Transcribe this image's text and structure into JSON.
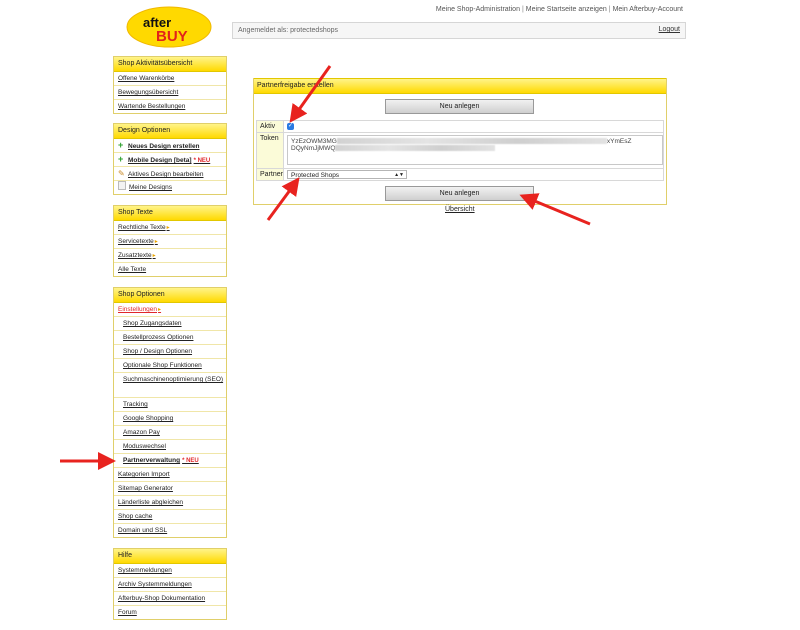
{
  "logo": {
    "text_top": "after",
    "text_bottom": "BUY"
  },
  "top_links": [
    "Meine Shop-Administration",
    "Meine Startseite anzeigen",
    "Mein Afterbuy-Account"
  ],
  "login_bar": {
    "label": "Angemeldet als: protectedshops",
    "logout": "Logout"
  },
  "sidebar": {
    "activity": {
      "title": "Shop Aktivitätsübersicht",
      "items": [
        "Offene Warenkörbe",
        "Bewegungsübersicht",
        "Wartende Bestellungen"
      ]
    },
    "design": {
      "title": "Design Optionen",
      "items": [
        "Neues Design erstellen",
        "Mobile Design [beta]",
        "Aktives Design bearbeiten",
        "Meine Designs"
      ],
      "neu_badge": "* NEU"
    },
    "texts": {
      "title": "Shop Texte",
      "items": [
        "Rechtliche Texte",
        "Servicetexte",
        "Zusatztexte",
        "Alle Texte"
      ]
    },
    "options": {
      "title": "Shop Optionen",
      "items": [
        "Einstellungen",
        "Shop Zugangsdaten",
        "Bestellprozess Optionen",
        "Shop / Design Optionen",
        "Optionale Shop Funktionen",
        "Suchmaschinenoptimierung (SEO)",
        "Tracking",
        "Google Shopping",
        "Amazon Pay",
        "Moduswechsel",
        "Partnerverwaltung",
        "Kategorien Import",
        "Sitemap Generator",
        "Länderliste abgleichen",
        "Shop cache",
        "Domain und SSL"
      ],
      "neu_badge": "* NEU"
    },
    "help": {
      "title": "Hilfe",
      "items": [
        "Systemmeldungen",
        "Archiv Systemmeldungen",
        "Afterbuy-Shop Dokumentation",
        "Forum"
      ]
    }
  },
  "panel": {
    "title": "Partnerfreigabe erstellen",
    "button_top": "Neu anlegen",
    "aktiv_label": "Aktiv",
    "aktiv_checked": true,
    "token_label": "Token",
    "token_line1_start": "YzEzOWM3MG",
    "token_line1_end": "xYmEsZ",
    "token_line2_start": "DQyNmJjMWQ",
    "partner_label": "Partner",
    "partner_value": "Protected Shops",
    "button_bottom": "Neu anlegen",
    "overview_link": "Übersicht"
  },
  "colors": {
    "header_yellow": "#ffd900",
    "neu_red": "#e0272a",
    "arrow_red": "#e8231f",
    "check_blue": "#2a7ae2"
  }
}
